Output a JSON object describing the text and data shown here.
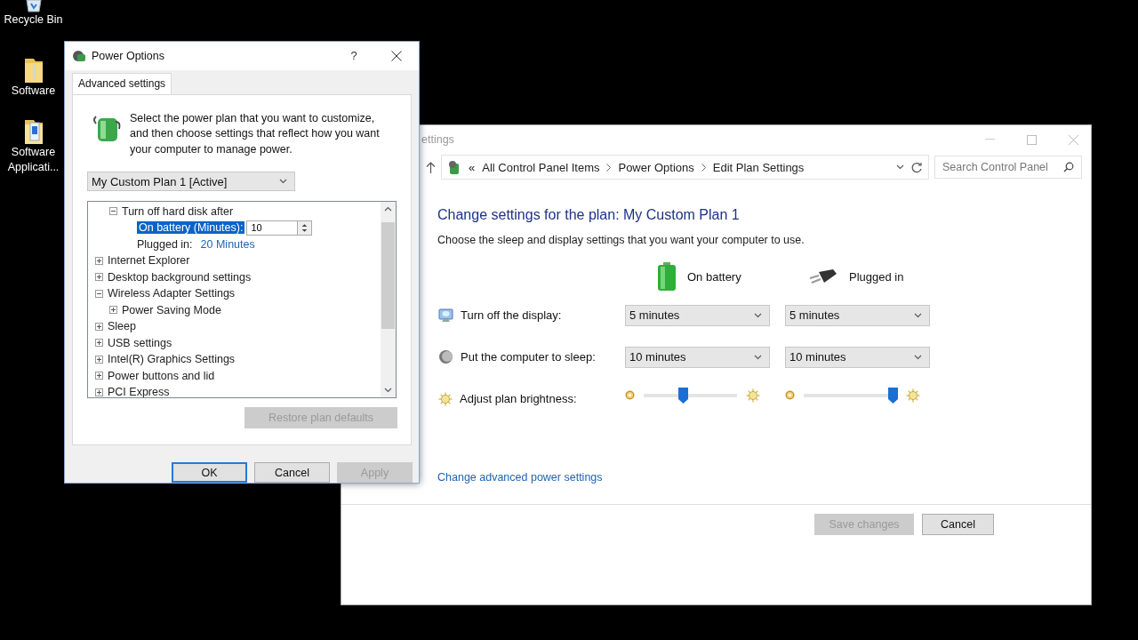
{
  "desktop_icons": [
    {
      "label": "Recycle Bin",
      "kind": "recycle-bin"
    },
    {
      "label": "Software",
      "kind": "folder"
    },
    {
      "label": "Software Applicati...",
      "kind": "app-folder"
    }
  ],
  "control_panel": {
    "title": "ettings",
    "breadcrumb": {
      "overflow": "«",
      "items": [
        "All Control Panel Items",
        "Power Options",
        "Edit Plan Settings"
      ]
    },
    "search": {
      "placeholder": "Search Control Panel"
    },
    "heading": "Change settings for the plan: My Custom Plan 1",
    "subheading": "Choose the sleep and display settings that you want your computer to use.",
    "columns": [
      {
        "label": "On battery",
        "kind": "battery"
      },
      {
        "label": "Plugged in",
        "kind": "plug"
      }
    ],
    "settings": [
      {
        "label": "Turn off the display:",
        "kind": "display",
        "values": [
          "5 minutes",
          "5 minutes"
        ]
      },
      {
        "label": "Put the computer to sleep:",
        "kind": "sleep",
        "values": [
          "10 minutes",
          "10 minutes"
        ]
      },
      {
        "label": "Adjust plan brightness:",
        "kind": "brightness",
        "sliders": [
          {
            "level": 0.42
          },
          {
            "level": 0.95
          }
        ]
      }
    ],
    "link": "Change advanced power settings",
    "buttons": [
      {
        "label": "Save changes",
        "disabled": true
      },
      {
        "label": "Cancel",
        "disabled": false
      }
    ]
  },
  "dialog": {
    "title": "Power Options",
    "help": "?",
    "tabs": [
      {
        "label": "Advanced settings",
        "selected": true
      }
    ],
    "intro": "Select the power plan that you want to customize, and then choose settings that reflect how you want your computer to manage power.",
    "plan": "My Custom Plan 1 [Active]",
    "tree": {
      "continued_items": [
        {
          "label": "Turn off hard disk after",
          "expanded": true,
          "children": [
            {
              "kind": "spin",
              "label": "On battery (Minutes):",
              "value": "10",
              "selected": true
            },
            {
              "kind": "value",
              "label": "Plugged in:",
              "value": "20 Minutes",
              "selected": false
            }
          ]
        }
      ],
      "items": [
        {
          "label": "Internet Explorer",
          "expanded": false
        },
        {
          "label": "Desktop background settings",
          "expanded": false
        },
        {
          "label": "Wireless Adapter Settings",
          "expanded": true,
          "children": [
            {
              "label": "Power Saving Mode",
              "expanded": false
            }
          ]
        },
        {
          "label": "Sleep",
          "expanded": false
        },
        {
          "label": "USB settings",
          "expanded": false
        },
        {
          "label": "Intel(R) Graphics Settings",
          "expanded": false
        },
        {
          "label": "Power buttons and lid",
          "expanded": false
        },
        {
          "label": "PCI Express",
          "expanded": false
        }
      ]
    },
    "restore_button": {
      "label": "Restore plan defaults",
      "disabled": true
    },
    "buttons": [
      {
        "label": "OK",
        "disabled": false,
        "default": true
      },
      {
        "label": "Cancel",
        "disabled": false,
        "default": false
      },
      {
        "label": "Apply",
        "disabled": true,
        "default": false
      }
    ]
  }
}
